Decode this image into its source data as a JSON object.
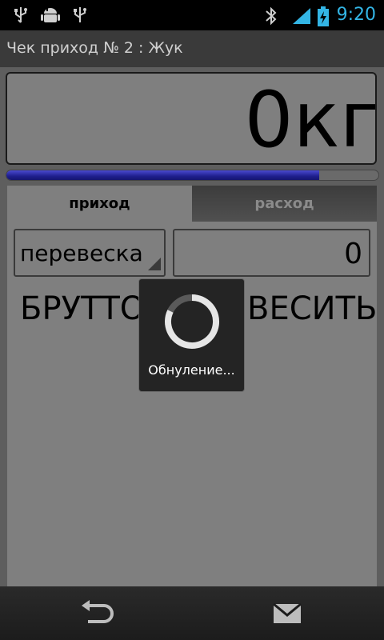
{
  "status_bar": {
    "time": "9:20",
    "icons": [
      "usb-icon",
      "android-debug-icon",
      "usb-icon",
      "bluetooth-icon",
      "signal-icon",
      "battery-charging-icon"
    ],
    "accent_color": "#33b5e5"
  },
  "title_bar": {
    "title": "Чек приход № 2 : Жук"
  },
  "scale": {
    "weight": "0кг",
    "progress_fraction": 0.84
  },
  "tabs": [
    {
      "label": "приход",
      "selected": true
    },
    {
      "label": "расход",
      "selected": false
    }
  ],
  "form": {
    "mode_selected": "перевеска",
    "value": "0"
  },
  "actions": {
    "gross_label": "БРУТТО",
    "reweigh_label": "ВЕСИТЬ"
  },
  "dialog": {
    "message": "Обнуление..."
  },
  "nav_bar": {
    "icons": [
      "back-icon",
      "mail-icon"
    ]
  }
}
